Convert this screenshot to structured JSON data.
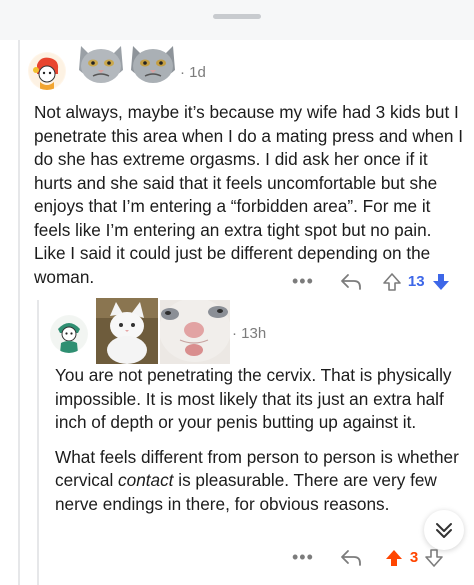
{
  "comment1": {
    "time": "1d",
    "body": "Not always, maybe it’s because my wife had 3 kids but I penetrate this area when I do a mating press and when I do she has extreme orgasms. I did ask her once if it hurts and she said that it feels uncomfortable but she enjoys that I’m entering a “forbidden area”. For me it feels like I’m entering an extra tight spot but no pain. Like I said it could just be different depending on the woman.",
    "score": "13",
    "score_color": "#3d67e8"
  },
  "comment2": {
    "time": "13h",
    "para1": "You are not penetrating the cervix. That is physically impossible. It is most likely that its just an extra half inch of depth or your penis butting up against it.",
    "para2_start": "What feels different from person to person is whether cervical ",
    "para2_em": "contact",
    "para2_end": " is pleasurable. There are very few nerve endings in there, for obvious reasons.",
    "score": "3",
    "score_color": "#ff4500"
  },
  "icons": {
    "more": "more-icon",
    "reply": "reply-arrow-icon",
    "upvote": "upvote-icon",
    "downvote": "downvote-icon",
    "scroll": "chevron-double-down-icon"
  },
  "ui": {
    "more_glyph": "•••"
  }
}
